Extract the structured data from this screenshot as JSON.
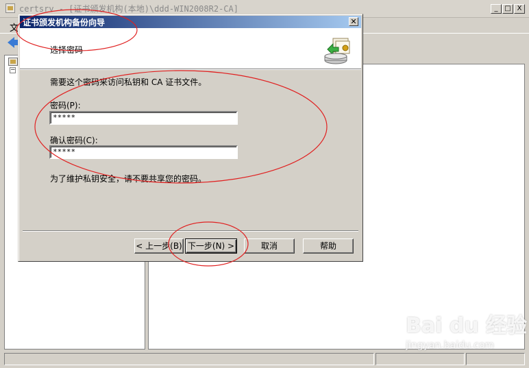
{
  "console": {
    "title": "certsrv - [证书颁发机构(本地)\\ddd-WIN2008R2-CA]",
    "menu_first": "文",
    "window_buttons": {
      "minimize": "_",
      "maximize": "□",
      "close": "X"
    }
  },
  "dialog": {
    "title": "证书颁发机构备份向导",
    "close_glyph": "✕",
    "header_title": "选择密码",
    "intro": "需要这个密码来访问私钥和 CA 证书文件。",
    "password_label": "密码(P):",
    "password_value": "*****",
    "confirm_label": "确认密码(C):",
    "confirm_value": "*****",
    "note": "为了维护私钥安全，请不要共享您的密码。",
    "buttons": {
      "back": "< 上一步(B)",
      "next": "下一步(N) >",
      "cancel": "取消",
      "help": "帮助"
    }
  },
  "watermark": {
    "logo": "Bai du 经验",
    "url": "jingyan.baidu.com"
  },
  "annotation_color": "#e02020"
}
